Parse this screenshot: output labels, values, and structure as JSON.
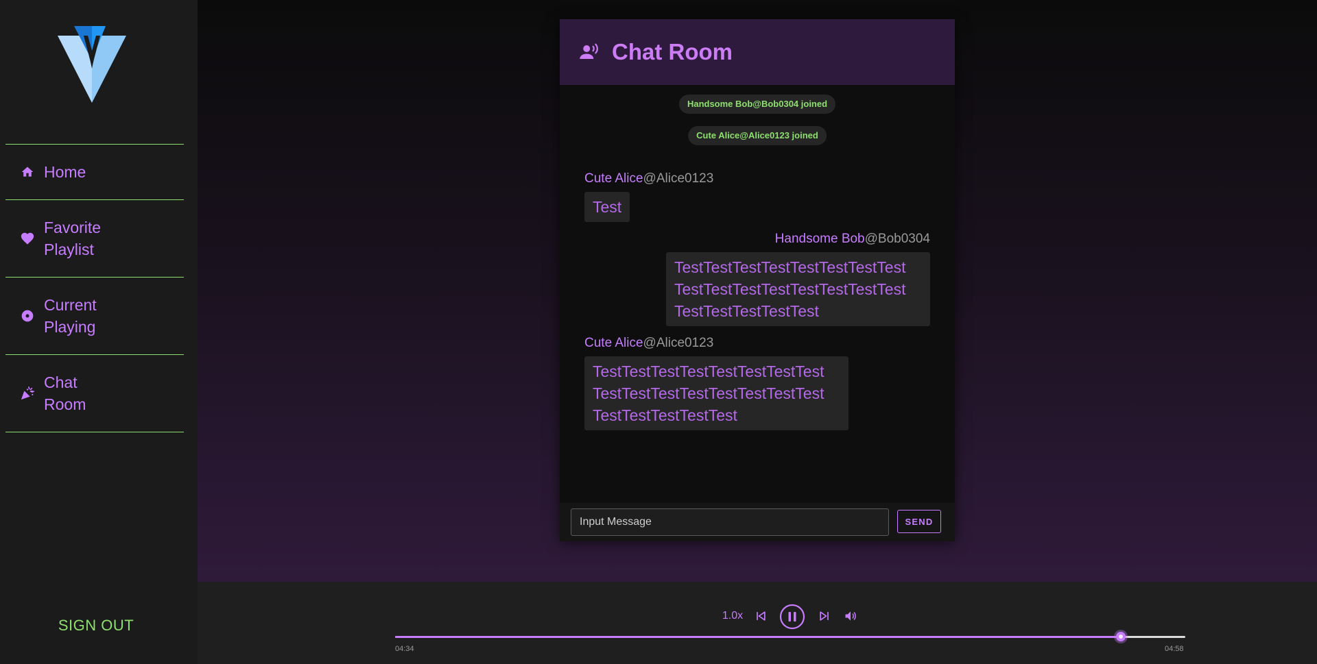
{
  "sidebar": {
    "items": [
      {
        "label": "Home",
        "icon": "home-icon"
      },
      {
        "label": "Favorite Playlist",
        "icon": "heart-icon"
      },
      {
        "label": "Current Playing",
        "icon": "disc-icon"
      },
      {
        "label": "Chat Room",
        "icon": "party-popper-icon"
      }
    ],
    "signout_label": "SIGN OUT"
  },
  "chat": {
    "title": "Chat Room",
    "system_messages": [
      "Handsome Bob@Bob0304 joined",
      "Cute Alice@Alice0123 joined"
    ],
    "messages": [
      {
        "name": "Cute Alice",
        "handle": "@Alice0123",
        "text": "Test",
        "side": "left"
      },
      {
        "name": "Handsome Bob",
        "handle": "@Bob0304",
        "text": "TestTestTestTestTestTestTestTest TestTestTestTestTestTestTestTest TestTestTestTestTest",
        "side": "right"
      },
      {
        "name": "Cute Alice",
        "handle": "@Alice0123",
        "text": "TestTestTestTestTestTestTestTest TestTestTestTestTestTestTestTest TestTestTestTestTest",
        "side": "left"
      }
    ],
    "input_placeholder": "Input Message",
    "send_label": "SEND"
  },
  "player": {
    "speed": "1.0x",
    "current_time": "04:34",
    "total_time": "04:58",
    "progress": 0.918
  },
  "colors": {
    "accent": "#c77dff",
    "green": "#8ee06e"
  }
}
